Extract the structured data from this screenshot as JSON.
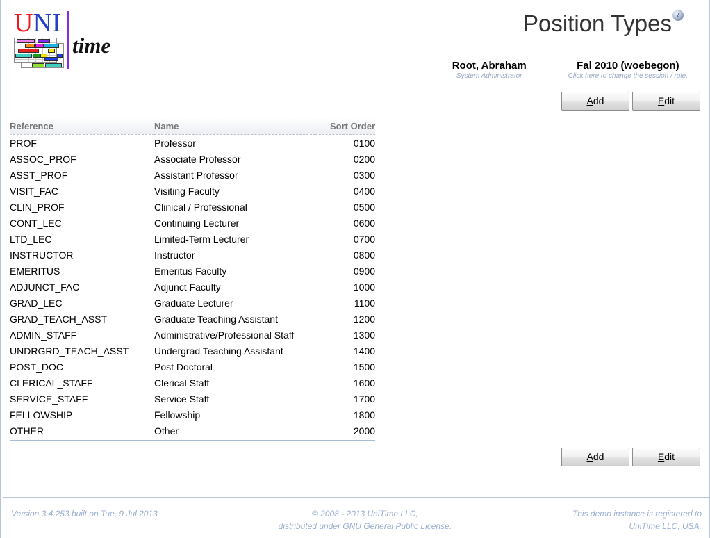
{
  "app": {
    "logo": {
      "uni_u": "U",
      "uni_n": "NI",
      "time": "time"
    }
  },
  "header": {
    "title": "Position Types",
    "help_icon_label": "?",
    "user": {
      "name": "Root, Abraham",
      "role": "System Administrator"
    },
    "session": {
      "term": "Fal 2010 (woebegon)",
      "change_hint": "Click here to change the session / role."
    }
  },
  "toolbar": {
    "add_accel": "A",
    "add_rest": "dd",
    "edit_accel": "E",
    "edit_rest": "dit"
  },
  "table": {
    "columns": {
      "reference": "Reference",
      "name": "Name",
      "sort_order": "Sort Order"
    },
    "rows": [
      {
        "reference": "PROF",
        "name": "Professor",
        "sort_order": "0100"
      },
      {
        "reference": "ASSOC_PROF",
        "name": "Associate Professor",
        "sort_order": "0200"
      },
      {
        "reference": "ASST_PROF",
        "name": "Assistant Professor",
        "sort_order": "0300"
      },
      {
        "reference": "VISIT_FAC",
        "name": "Visiting Faculty",
        "sort_order": "0400"
      },
      {
        "reference": "CLIN_PROF",
        "name": "Clinical / Professional",
        "sort_order": "0500"
      },
      {
        "reference": "CONT_LEC",
        "name": "Continuing Lecturer",
        "sort_order": "0600"
      },
      {
        "reference": "LTD_LEC",
        "name": "Limited-Term Lecturer",
        "sort_order": "0700"
      },
      {
        "reference": "INSTRUCTOR",
        "name": "Instructor",
        "sort_order": "0800"
      },
      {
        "reference": "EMERITUS",
        "name": "Emeritus Faculty",
        "sort_order": "0900"
      },
      {
        "reference": "ADJUNCT_FAC",
        "name": "Adjunct Faculty",
        "sort_order": "1000"
      },
      {
        "reference": "GRAD_LEC",
        "name": "Graduate Lecturer",
        "sort_order": "1100"
      },
      {
        "reference": "GRAD_TEACH_ASST",
        "name": "Graduate Teaching Assistant",
        "sort_order": "1200"
      },
      {
        "reference": "ADMIN_STAFF",
        "name": "Administrative/Professional Staff",
        "sort_order": "1300"
      },
      {
        "reference": "UNDRGRD_TEACH_ASST",
        "name": "Undergrad Teaching Assistant",
        "sort_order": "1400"
      },
      {
        "reference": "POST_DOC",
        "name": "Post Doctoral",
        "sort_order": "1500"
      },
      {
        "reference": "CLERICAL_STAFF",
        "name": "Clerical Staff",
        "sort_order": "1600"
      },
      {
        "reference": "SERVICE_STAFF",
        "name": "Service Staff",
        "sort_order": "1700"
      },
      {
        "reference": "FELLOWSHIP",
        "name": "Fellowship",
        "sort_order": "1800"
      },
      {
        "reference": "OTHER",
        "name": "Other",
        "sort_order": "2000"
      }
    ]
  },
  "footer": {
    "version": "Version 3.4.253 built on Tue, 9 Jul 2013",
    "copyright_line1": "© 2008 - 2013 UniTime LLC,",
    "copyright_line2": "distributed under GNU General Public License.",
    "registration_line1": "This demo instance is registered to",
    "registration_line2": "UniTime LLC, USA."
  },
  "colors": {
    "border": "#b7c4da",
    "rule": "#a9bcd6",
    "header_text": "#767676",
    "footer_text": "#9aaed0",
    "title_text": "#333333",
    "sub_text": "#9aa9c4"
  }
}
